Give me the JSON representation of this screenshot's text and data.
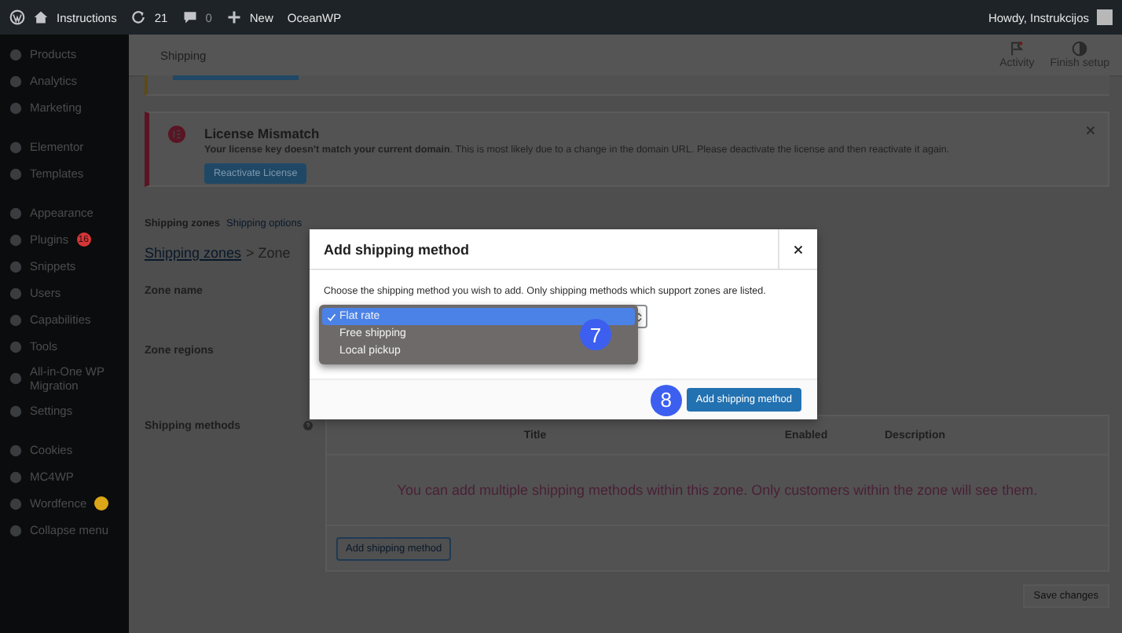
{
  "admin_bar": {
    "site": "Instructions",
    "updates": "21",
    "comments": "0",
    "new": "New",
    "theme": "OceanWP",
    "greeting": "Howdy, Instrukcijos"
  },
  "sidebar": {
    "groups": [
      [
        {
          "label": "Products"
        },
        {
          "label": "Analytics"
        },
        {
          "label": "Marketing"
        }
      ],
      [
        {
          "label": "Elementor"
        },
        {
          "label": "Templates"
        }
      ],
      [
        {
          "label": "Appearance"
        },
        {
          "label": "Plugins",
          "badge": {
            "text": "16",
            "color": "#d63638"
          }
        },
        {
          "label": "Snippets"
        },
        {
          "label": "Users"
        },
        {
          "label": "Capabilities"
        },
        {
          "label": "Tools"
        },
        {
          "label": "All-in-One WP Migration"
        },
        {
          "label": "Settings"
        }
      ],
      [
        {
          "label": "Cookies"
        },
        {
          "label": "MC4WP"
        },
        {
          "label": "Wordfence",
          "badge": {
            "color": "#dba617"
          }
        },
        {
          "label": "Collapse menu"
        }
      ]
    ]
  },
  "header": {
    "title": "Shipping",
    "actions": [
      {
        "label": "Activity",
        "kind": "flag"
      },
      {
        "label": "Finish setup",
        "kind": "progress"
      }
    ]
  },
  "notice": {
    "title": "License Mismatch",
    "message": "**Your license key doesn't match your current domain**. This is most likely due to a change in the domain URL. Please deactivate the license and then reactivate it again.",
    "button": "Reactivate License"
  },
  "tabs": [
    {
      "label": "Shipping zones",
      "selected": true
    },
    {
      "label": "Shipping options",
      "selected": false
    }
  ],
  "breadcrumb": {
    "link": "Shipping zones",
    "current": "> Zone"
  },
  "form": {
    "rows": [
      {
        "label": "Zone name"
      },
      {
        "label": "Zone regions"
      }
    ],
    "methods_label": "Shipping methods"
  },
  "methods_table": {
    "columns": [
      "Title",
      "Enabled",
      "Description"
    ],
    "empty_message": "You can add multiple shipping methods within this zone. Only customers within the zone will see them.",
    "button": "Add shipping method"
  },
  "save_button": "Save changes",
  "modal": {
    "title": "Add shipping method",
    "description": "Choose the shipping method you wish to add. Only shipping methods which support zones are listed.",
    "options": [
      {
        "label": "Flat rate",
        "selected": true
      },
      {
        "label": "Free shipping",
        "selected": false
      },
      {
        "label": "Local pickup",
        "selected": false
      }
    ],
    "button": "Add shipping method"
  },
  "callouts": [
    {
      "number": "7"
    },
    {
      "number": "8"
    }
  ]
}
